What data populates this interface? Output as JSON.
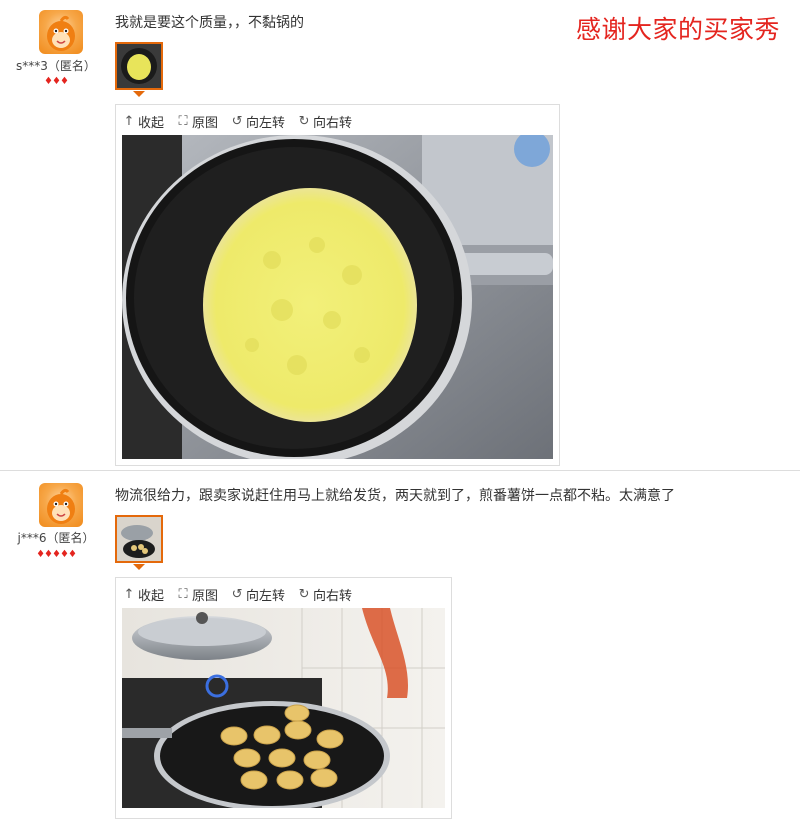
{
  "banner": "感谢大家的买家秀",
  "reviews": [
    {
      "user": "s***3（匿名）",
      "hearts": "♦♦♦",
      "comment": "我就是要这个质量，，不黏锅的",
      "tools": {
        "collapse": "收起",
        "original": "原图",
        "rotate_left": "向左转",
        "rotate_right": "向右转"
      }
    },
    {
      "user": "j***6（匿名）",
      "hearts": "♦♦♦♦♦",
      "comment": "物流很给力，跟卖家说赶住用马上就给发货，两天就到了，煎番薯饼一点都不粘。太满意了",
      "tools": {
        "collapse": "收起",
        "original": "原图",
        "rotate_left": "向左转",
        "rotate_right": "向右转"
      }
    }
  ],
  "icons": {
    "collapse": "↑",
    "original": "⛶",
    "rotate_left": "↺",
    "rotate_right": "↻"
  },
  "colors": {
    "banner": "#e4251f",
    "accent": "#e4690b",
    "heart": "#e4251f"
  }
}
